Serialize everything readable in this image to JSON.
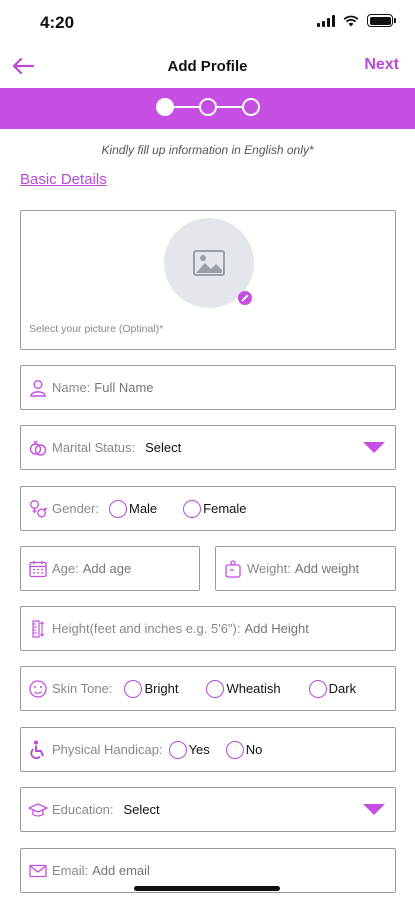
{
  "status_bar": {
    "time": "4:20"
  },
  "header": {
    "title": "Add Profile",
    "next_label": "Next"
  },
  "info_text": "Kindly fill up information in English only*",
  "section_title": "Basic Details",
  "photo": {
    "caption": "Select your picture (Optinal)*"
  },
  "name": {
    "label": "Name:",
    "placeholder": "Full Name"
  },
  "marital_status": {
    "label": "Marital Status:",
    "value": "Select"
  },
  "gender": {
    "label": "Gender:",
    "options": [
      "Male",
      "Female"
    ]
  },
  "age": {
    "label": "Age:",
    "placeholder": "Add age"
  },
  "weight": {
    "label": "Weight:",
    "placeholder": "Add weight"
  },
  "height": {
    "label": "Height(feet and inches e.g. 5'6\"):",
    "placeholder": "Add Height"
  },
  "skin_tone": {
    "label": "Skin Tone:",
    "options": [
      "Bright",
      "Wheatish",
      "Dark"
    ]
  },
  "physical_handicap": {
    "label": "Physical Handicap:",
    "options": [
      "Yes",
      "No"
    ]
  },
  "education": {
    "label": "Education:",
    "value": "Select"
  },
  "email": {
    "label": "Email:",
    "placeholder": "Add email"
  },
  "colors": {
    "accent": "#c44fe0",
    "accent_text": "#b94ad6",
    "border": "#9a9a9a"
  },
  "icons": [
    "back-arrow-icon",
    "image-placeholder-icon",
    "edit-icon",
    "user-icon",
    "rings-icon",
    "gender-icon",
    "calendar-icon",
    "weight-icon",
    "height-icon",
    "smiley-icon",
    "wheelchair-icon",
    "graduation-cap-icon",
    "mail-icon",
    "dropdown-arrow-icon"
  ]
}
